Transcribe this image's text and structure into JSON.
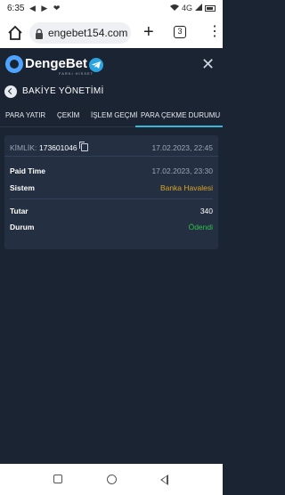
{
  "status_bar": {
    "time": "6:35",
    "left_icons": "◀ ▶ ❤",
    "signal_label": "4G"
  },
  "browser": {
    "url": "engebet154.com",
    "tab_count": "3",
    "new_tab_symbol": "+",
    "menu_symbol": "⋮"
  },
  "header": {
    "logo_text": "DengeBet",
    "logo_sub": "FARKI HİSSET",
    "close_symbol": "✕"
  },
  "page": {
    "title": "BAKİYE YÖNETİMİ"
  },
  "tabs": [
    {
      "label": "PARA YATIR",
      "active": false
    },
    {
      "label": "ÇEKİM",
      "active": false
    },
    {
      "label": "İŞLEM GEÇMİ",
      "active": false
    },
    {
      "label": "PARA ÇEKME DURUMU",
      "active": true
    }
  ],
  "record": {
    "id_label": "KİMLİK:",
    "id_value": "173601046",
    "date": "17.02.2023, 22:45",
    "rows": [
      {
        "label": "Paid Time",
        "value": "17.02.2023, 23:30",
        "color": "#9aa5b5"
      },
      {
        "label": "Sistem",
        "value": "Banka Havalesi",
        "color": "#d9a425"
      },
      {
        "label": "Tutar",
        "value": "340",
        "color": "#ffffff"
      },
      {
        "label": "Durum",
        "value": "Ödendi",
        "color": "#2fbf4a"
      }
    ]
  },
  "colors": {
    "background": "#1b2433",
    "card": "#243042",
    "accent": "#36b6d8"
  }
}
